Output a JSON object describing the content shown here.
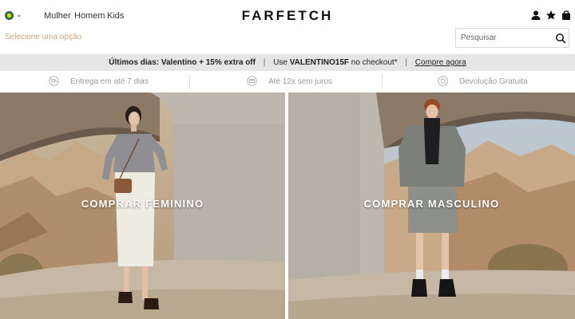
{
  "header": {
    "country_flag": "brazil-flag-icon",
    "nav": [
      {
        "label": "Mulher"
      },
      {
        "label": "Homem"
      },
      {
        "label": "Kids"
      }
    ],
    "logo": "FARFETCH",
    "selector_label": "Selecione uma opção",
    "search_placeholder": "Pesquisar"
  },
  "promo": {
    "part1": "Últimos dias: Valentino + 15% extra off",
    "part2_prefix": "Use",
    "code": "VALENTINO15F",
    "part2_suffix": "no checkout*",
    "sep": "|",
    "link": "Compre agora"
  },
  "perks": [
    {
      "label": "Entrega em até 7 dias",
      "icon": "delivery-icon"
    },
    {
      "label": "Até 12x sem juros",
      "icon": "credit-card-icon"
    },
    {
      "label": "Devolução Gratuita",
      "icon": "return-icon"
    }
  ],
  "hero": {
    "left_cta": "COMPRAR FEMININO",
    "right_cta": "COMPRAR MASCULINO"
  },
  "colors": {
    "accent_selector": "#d8a06a",
    "promo_bg": "#e6e6e6",
    "perk_text": "#9a9a9a"
  }
}
